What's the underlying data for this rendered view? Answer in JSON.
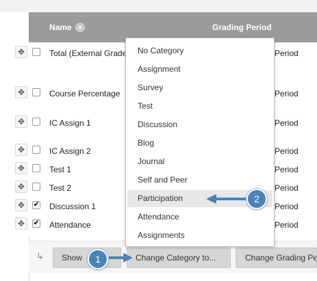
{
  "header": {
    "name_label": "Name",
    "sort_icon": "chevron-down-icon",
    "period_label": "Grading Period"
  },
  "rows": [
    {
      "name": "Total (External Grade",
      "period": "Period",
      "checked": false
    },
    {
      "name": "Course Percentage",
      "period": "Period",
      "checked": false
    },
    {
      "name": "IC Assign 1",
      "period": "Period",
      "checked": false
    },
    {
      "name": "IC Assign 2",
      "period": "Period",
      "checked": false
    },
    {
      "name": "Test 1",
      "period": "Period",
      "checked": false
    },
    {
      "name": "Test 2",
      "period": "Period",
      "checked": false
    },
    {
      "name": "Discussion 1",
      "period": "Period",
      "checked": true
    },
    {
      "name": "Attendance",
      "period": "Period",
      "checked": true
    }
  ],
  "icons": {
    "drag": "drag-handle-icon",
    "check": "checkmark-icon",
    "corner_arrow": "corner-arrow-icon"
  },
  "toolbar": {
    "show_label": "Show",
    "change_category_label": "Change Category to...",
    "change_grading_label": "Change Grading Pe"
  },
  "dropdown": {
    "items": [
      "No Category",
      "Assignment",
      "Survey",
      "Test",
      "Discussion",
      "Blog",
      "Journal",
      "Self and Peer",
      "Participation",
      "Attendance",
      "Assignments"
    ],
    "selected": "Participation"
  },
  "callouts": [
    {
      "number": "1"
    },
    {
      "number": "2"
    }
  ],
  "colors": {
    "header_bg": "#9b9b9b",
    "callout_blue": "#4a83b8",
    "menu_highlight": "#e8e8e8"
  }
}
